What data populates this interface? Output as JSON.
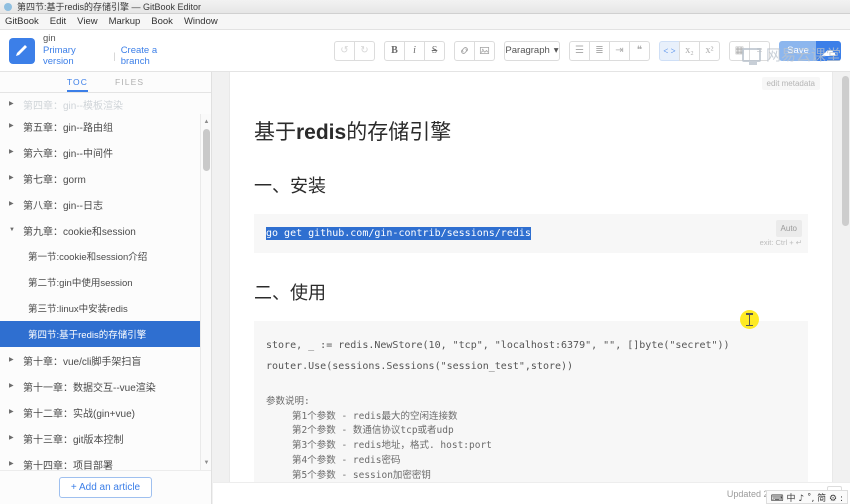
{
  "window": {
    "title": "第四节:基于redis的存储引擎 — GitBook Editor"
  },
  "menubar": {
    "items": [
      "GitBook",
      "Edit",
      "View",
      "Markup",
      "Book",
      "Window"
    ]
  },
  "header": {
    "book_name": "gin",
    "version_label": "Primary version",
    "separator": "|",
    "create_branch_label": "Create a branch",
    "watermark": "网易云课堂",
    "toolbar": {
      "undo": "↺",
      "redo": "↻",
      "bold": "B",
      "italic": "i",
      "strikethrough": "S",
      "link": "🔗",
      "image": "▣",
      "paragraph": "Paragraph",
      "paragraph_caret": "▾",
      "bullet_list": "☰",
      "ordered_list": "≣",
      "task_list": "⇥",
      "quote": "❝",
      "code": "< >",
      "subscript": "x₂",
      "superscript": "x²",
      "table": "▦",
      "hr": "≡",
      "save": "Save",
      "sync": "☁"
    },
    "accent_color": "#3c7fe8"
  },
  "sidebar": {
    "tabs": [
      {
        "label": "TOC",
        "active": true
      },
      {
        "label": "FILES",
        "active": false
      }
    ],
    "items": [
      {
        "label": "第四章：gin--模板渲染",
        "level": "chapter",
        "state": "faded",
        "selected": false
      },
      {
        "label": "第五章：gin--路由组",
        "level": "chapter",
        "state": "normal",
        "selected": false
      },
      {
        "label": "第六章：gin--中间件",
        "level": "chapter",
        "state": "normal",
        "selected": false
      },
      {
        "label": "第七章：gorm",
        "level": "chapter",
        "state": "normal",
        "selected": false
      },
      {
        "label": "第八章：gin--日志",
        "level": "chapter",
        "state": "normal",
        "selected": false
      },
      {
        "label": "第九章：cookie和session",
        "level": "chapter",
        "state": "expanded",
        "selected": false
      },
      {
        "label": "第一节:cookie和session介绍",
        "level": "section",
        "state": "normal",
        "selected": false
      },
      {
        "label": "第二节:gin中使用session",
        "level": "section",
        "state": "normal",
        "selected": false
      },
      {
        "label": "第三节:linux中安装redis",
        "level": "section",
        "state": "normal",
        "selected": false
      },
      {
        "label": "第四节:基于redis的存储引擎",
        "level": "section",
        "state": "normal",
        "selected": true
      },
      {
        "label": "第十章：vue/cli脚手架扫盲",
        "level": "chapter",
        "state": "normal",
        "selected": false
      },
      {
        "label": "第十一章：数据交互--vue渲染",
        "level": "chapter",
        "state": "normal",
        "selected": false
      },
      {
        "label": "第十二章：实战(gin+vue)",
        "level": "chapter",
        "state": "normal",
        "selected": false
      },
      {
        "label": "第十三章：git版本控制",
        "level": "chapter",
        "state": "normal",
        "selected": false
      },
      {
        "label": "第十四章：项目部署",
        "level": "chapter",
        "state": "normal",
        "selected": false
      }
    ],
    "caret_collapsed": "▶",
    "caret_expanded": "▼",
    "add_article_label": "+ Add an article",
    "selected_color": "#2f6fd0"
  },
  "document": {
    "edit_metadata_label": "edit metadata",
    "title_prefix": "基于",
    "title_bold": "redis",
    "title_suffix": "的存储引擎",
    "heading_install": "一、安装",
    "heading_usage": "二、使用",
    "code_install": "go get github.com/gin-contrib/sessions/redis",
    "code_auto_badge": "Auto",
    "code_exit_hint": "exit: Ctrl + ↵",
    "code_usage_line1": "store, _ := redis.NewStore(10, \"tcp\", \"localhost:6379\", \"\", []byte(\"secret\"))",
    "code_usage_line2": "router.Use(sessions.Sessions(\"session_test\",store))",
    "params_title": "参数说明:",
    "params": [
      "第1个参数  -  redis最大的空闲连接数",
      "第2个参数  -  数通信协议tcp或者udp",
      "第3个参数  -  redis地址，格式. host:port",
      "第4个参数  -  redis密码",
      "第5个参数  -  session加密密钥"
    ]
  },
  "statusbar": {
    "updated_text": "Updated 2 minutes ago",
    "help_label": "?",
    "ime": "⌨ 中 ♪ ˚, 简 ⚙ :"
  }
}
